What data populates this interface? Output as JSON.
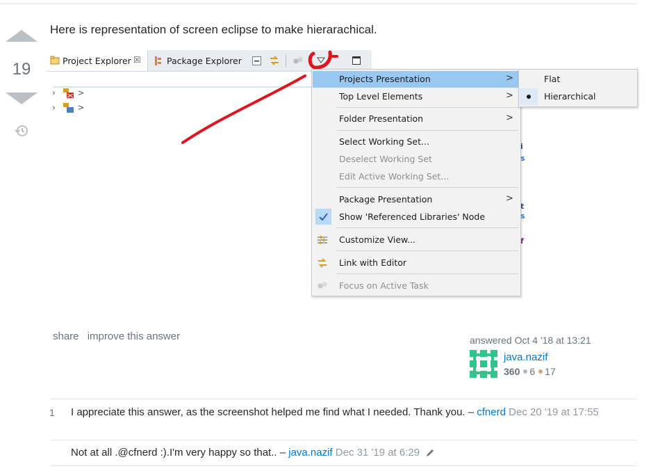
{
  "answer": {
    "score": "19",
    "text": "Here is representation of screen eclipse to make hierarachical."
  },
  "screenshot": {
    "tabs": [
      {
        "label": "Project Explorer",
        "active": true
      },
      {
        "label": "Package Explorer",
        "active": false
      }
    ],
    "tree_rows": [
      ">",
      ">"
    ],
    "menu": {
      "items": [
        {
          "label": "Projects Presentation",
          "submenu": ">",
          "state": "active"
        },
        {
          "label": "Top Level Elements",
          "submenu": ">"
        },
        {
          "label": "Folder Presentation",
          "submenu": ">"
        },
        {
          "label": "Select Working Set..."
        },
        {
          "label": "Deselect Working Set",
          "state": "disabled"
        },
        {
          "label": "Edit Active Working Set...",
          "state": "disabled"
        },
        {
          "label": "Package Presentation",
          "submenu": ">"
        },
        {
          "label": "Show 'Referenced Libraries' Node",
          "checked": true
        },
        {
          "label": "Customize View...",
          "icon": "customize-view-icon"
        },
        {
          "label": "Link with Editor",
          "icon": "link-editor-icon"
        },
        {
          "label": "Focus on Active Task",
          "icon": "focus-task-icon",
          "state": "disabled"
        }
      ]
    },
    "submenu": {
      "items": [
        {
          "label": "Flat"
        },
        {
          "label": "Hierarchical",
          "selected": true
        }
      ]
    },
    "annotation_color": "#e0141e"
  },
  "post_menu": {
    "share": "share",
    "improve": "improve this answer"
  },
  "signature": {
    "action": "answered Oct 4 '18 at 13:21",
    "user": "java.nazif",
    "reputation": "360",
    "silver": "6",
    "bronze": "17",
    "silver_color": "#b4b8bc",
    "bronze_color": "#d1a684",
    "avatar_color": "#31c48d"
  },
  "comments": [
    {
      "score": "1",
      "text": "I appreciate this answer, as the screenshot helped me find what I needed. Thank you. –",
      "user": "cfnerd",
      "date": "Dec 20 '19 at 17:55"
    },
    {
      "score": "",
      "text": "Not at all .@cfnerd :).I'm very happy so that.. –",
      "user": "java.nazif",
      "date": "Dec 31 '19 at 6:29"
    }
  ]
}
